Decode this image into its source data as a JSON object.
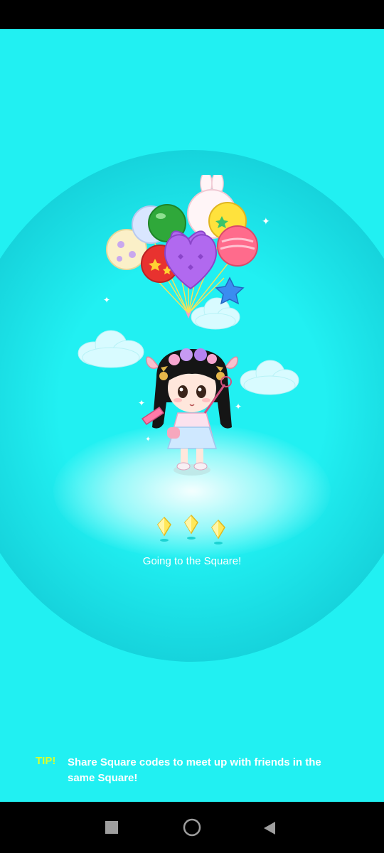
{
  "loading": {
    "message": "Going to the Square!"
  },
  "tip": {
    "label": "TIP!",
    "text": "Share Square codes to meet up with friends in the same Square!"
  },
  "icons": {
    "nav_recent": "square-stop-icon",
    "nav_home": "circle-home-icon",
    "nav_back": "triangle-back-icon",
    "gem": "yellow-gem-icon"
  },
  "colors": {
    "background": "#21f0f2",
    "tip_label": "#d7ff2e",
    "text": "#ffffff",
    "system_bars": "#000000"
  }
}
